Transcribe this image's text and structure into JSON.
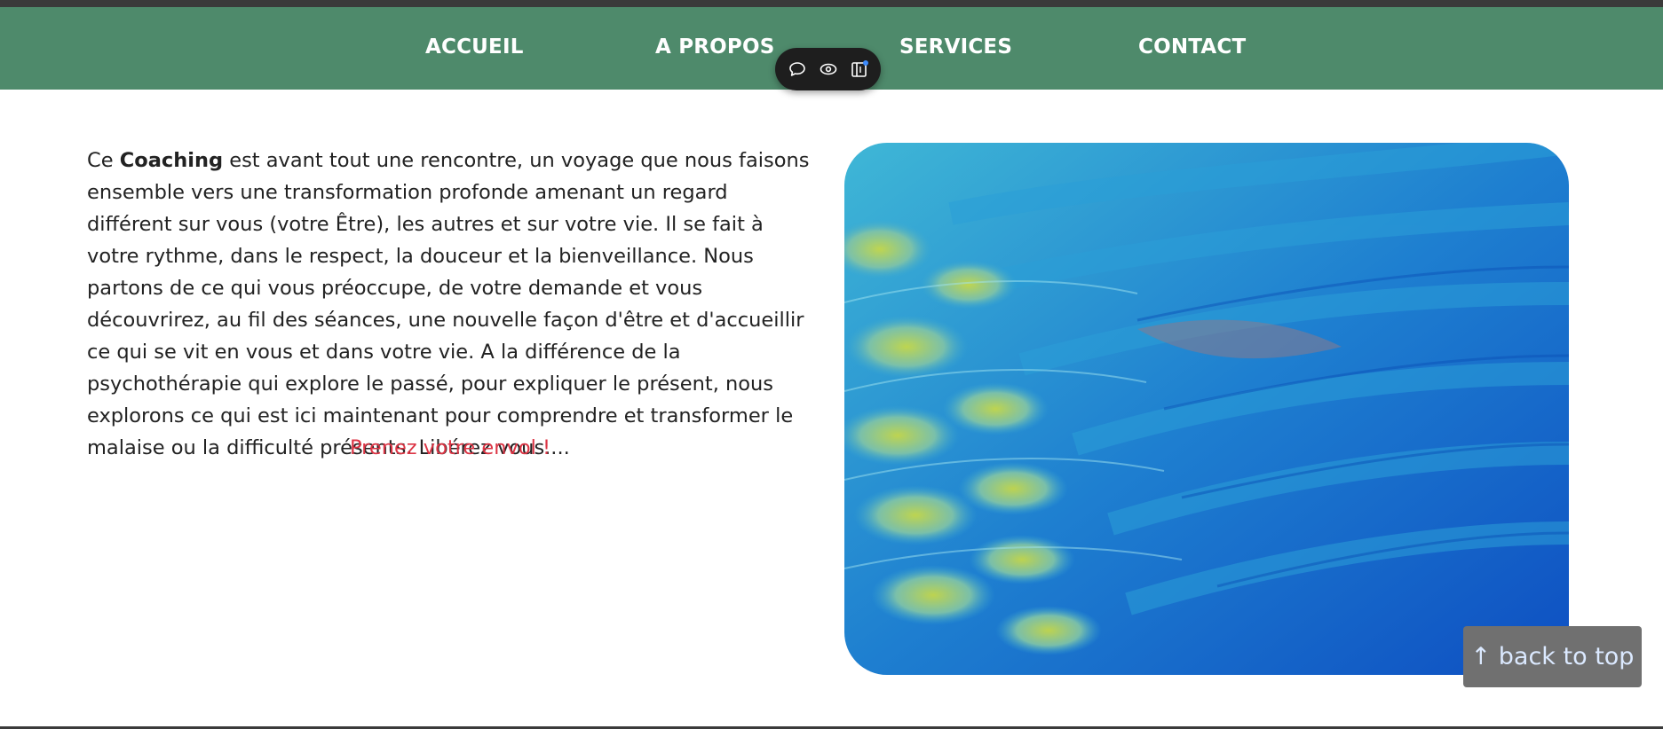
{
  "nav": {
    "items": [
      {
        "label": "ACCUEIL"
      },
      {
        "label": "A PROPOS"
      },
      {
        "label": "SERVICES"
      },
      {
        "label": "CONTACT"
      }
    ]
  },
  "toolbar": {
    "icons": [
      "comment-icon",
      "eye-icon",
      "panel-icon"
    ]
  },
  "content": {
    "intro": "Ce ",
    "bold": "Coaching",
    "body": " est avant tout une rencontre, un voyage que nous faisons ensemble vers une transformation profonde amenant un regard différent sur vous (votre Être), les autres et sur votre vie. Il se fait à votre rythme, dans le respect, la douceur et la bienveillance. Nous partons de ce qui vous préoccupe, de votre demande et vous découvrirez, au fil des séances, une nouvelle façon d'être et d'accueillir ce qui se vit en vous et dans votre vie. A la différence de la psychothérapie qui explore le passé, pour expliquer le présent, nous explorons ce qui est ici maintenant pour comprendre et transformer le malaise ou la difficulté présents. Libérez vous....",
    "tagline": "Prenez votre envol !"
  },
  "back_to_top": {
    "arrow": "↑",
    "label": "back to top"
  },
  "colors": {
    "navbar": "#4e8a6b",
    "tagline": "#dc3545",
    "back_to_top_bg": "#707070"
  }
}
